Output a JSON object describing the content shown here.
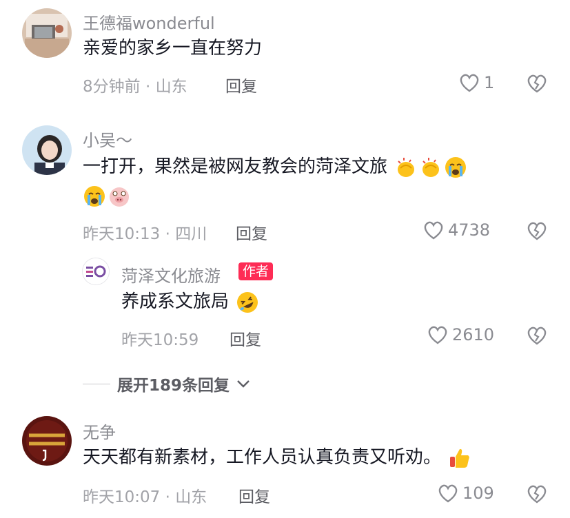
{
  "comments": [
    {
      "name": "王德福wonderful",
      "text": "亲爱的家乡一直在努力",
      "meta": "8分钟前 · 山东",
      "reply": "回复",
      "likes": "1",
      "emojis_inline": [],
      "emojis_line2": []
    },
    {
      "name": "小吴～",
      "text": "一打开，果然是被网友教会的菏泽文旅",
      "meta": "昨天10:13 · 四川",
      "reply": "回复",
      "likes": "4738",
      "emojis_inline": [
        "clapping-hands-emoji",
        "clapping-hands-emoji",
        "loudly-crying-emoji"
      ],
      "emojis_line2": [
        "loudly-crying-emoji",
        "pig-face-emoji"
      ]
    },
    {
      "name": "无争",
      "text": "天天都有新素材，工作人员认真负责又听劝。",
      "meta": "昨天10:07 · 山东",
      "reply": "回复",
      "likes": "109",
      "emojis_inline": [
        "thumbs-up-emoji"
      ],
      "emojis_line2": []
    }
  ],
  "reply": {
    "name": "菏泽文化旅游",
    "badge": "作者",
    "text": "养成系文旅局",
    "meta": "昨天10:59",
    "reply": "回复",
    "likes": "2610"
  },
  "expand_replies": "展开189条回复",
  "colors": {
    "badge": "#fe2c55",
    "meta": "#a2a3a8",
    "name": "#8a8b91"
  }
}
